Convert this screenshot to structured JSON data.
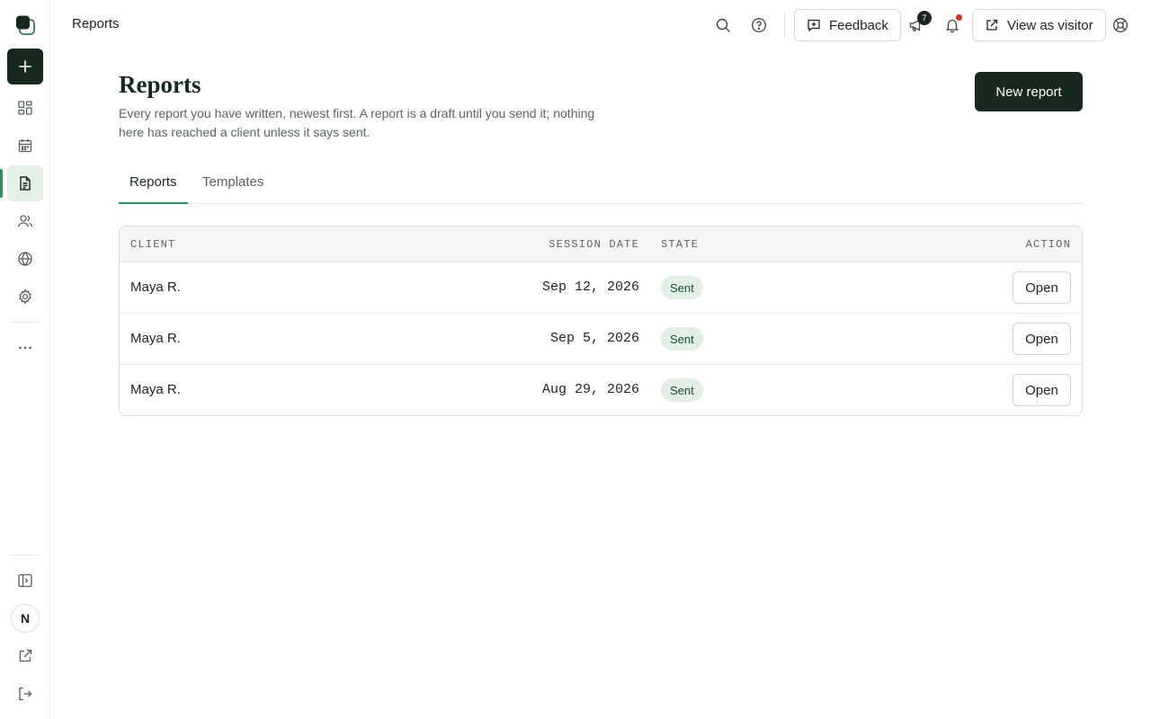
{
  "header": {
    "title": "Reports",
    "feedback_label": "Feedback",
    "announcements_count": "7",
    "view_as_visitor_label": "View as visitor"
  },
  "sidebar": {
    "items": [
      {
        "name": "new",
        "icon": "plus-icon"
      },
      {
        "name": "dashboard",
        "icon": "grid-icon"
      },
      {
        "name": "calendar",
        "icon": "calendar-icon"
      },
      {
        "name": "reports",
        "icon": "document-icon",
        "active": true
      },
      {
        "name": "clients",
        "icon": "users-icon"
      },
      {
        "name": "website",
        "icon": "globe-icon"
      },
      {
        "name": "settings",
        "icon": "gear-icon"
      },
      {
        "name": "more",
        "icon": "more-horizontal-icon"
      }
    ],
    "avatar_initial": "N"
  },
  "page": {
    "title": "Reports",
    "description": "Every report you have written, newest first. A report is a draft until you send it; nothing here has reached a client unless it says sent.",
    "new_button_label": "New report"
  },
  "tabs": [
    {
      "label": "Reports",
      "active": true
    },
    {
      "label": "Templates",
      "active": false
    }
  ],
  "table": {
    "columns": [
      "CLIENT",
      "SESSION DATE",
      "STATE",
      "ACTION"
    ],
    "rows": [
      {
        "client": "Maya R.",
        "date": "Sep 12, 2026",
        "state": "Sent",
        "action": "Open"
      },
      {
        "client": "Maya R.",
        "date": "Sep 5, 2026",
        "state": "Sent",
        "action": "Open"
      },
      {
        "client": "Maya R.",
        "date": "Aug 29, 2026",
        "state": "Sent",
        "action": "Open"
      }
    ]
  },
  "colors": {
    "brand_dark": "#17291f",
    "accent_green": "#2f8f58",
    "badge_bg": "#e1efe5",
    "notification_red": "#c8342a"
  }
}
